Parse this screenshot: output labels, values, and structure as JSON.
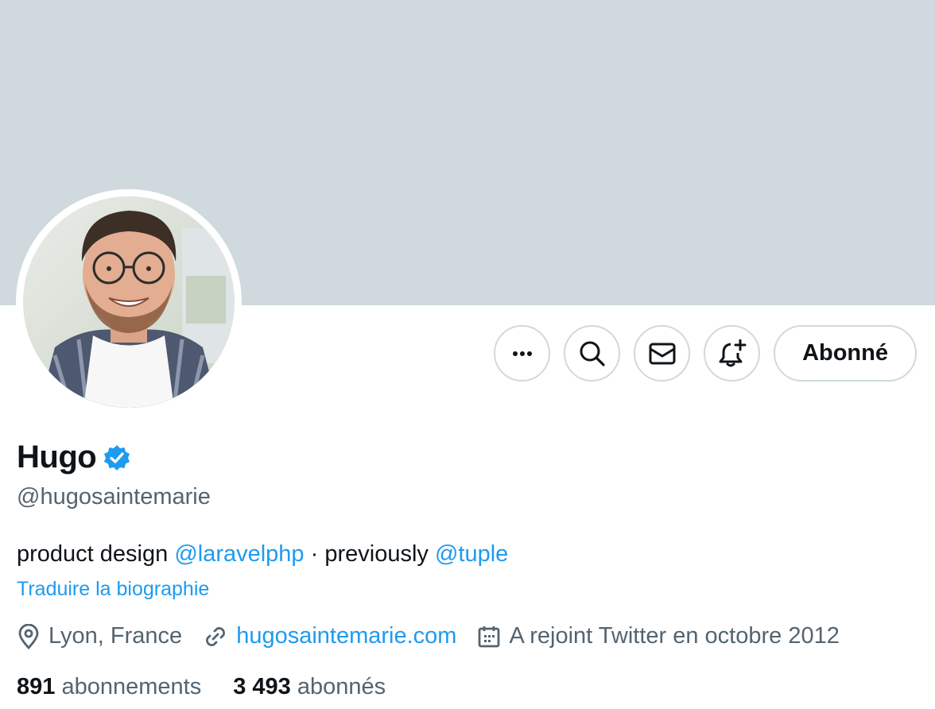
{
  "profile": {
    "display_name": "Hugo",
    "handle": "@hugosaintemarie",
    "verified": true,
    "verified_color": "#1d9bf0"
  },
  "actions": {
    "more_icon": "more-horizontal-icon",
    "search_icon": "search-icon",
    "message_icon": "mail-icon",
    "notify_icon": "bell-plus-icon",
    "follow_label": "Abonné"
  },
  "bio": {
    "part1": "product design ",
    "mention1": "@laravelphp",
    "part2": " · previously ",
    "mention2": "@tuple",
    "translate": "Traduire la biographie"
  },
  "meta": {
    "location": "Lyon, France",
    "website": "hugosaintemarie.com",
    "joined": "A rejoint Twitter en octobre 2012"
  },
  "stats": {
    "following_count": "891",
    "following_label": "abonnements",
    "followers_count": "3 493",
    "followers_label": "abonnés"
  },
  "colors": {
    "banner": "#cfd9de",
    "link": "#1d9bf0",
    "secondary_text": "#536471",
    "primary_text": "#0f1419"
  }
}
